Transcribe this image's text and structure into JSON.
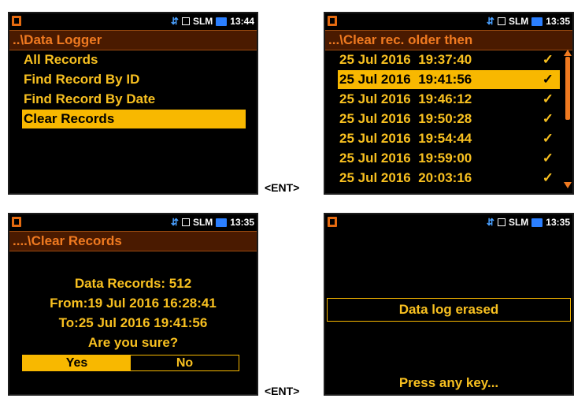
{
  "status": {
    "label": "SLM",
    "times": [
      "13:44",
      "13:35",
      "13:35",
      "13:35"
    ]
  },
  "panel1": {
    "title": "..\\Data Logger",
    "items": [
      "All Records",
      "Find Record By ID",
      "Find Record By Date",
      "Clear Records"
    ],
    "selected_index": 3
  },
  "panel2": {
    "title": "...\\Clear rec. older then",
    "records": [
      {
        "date": "25 Jul 2016",
        "time": "19:37:40",
        "mark": "✓"
      },
      {
        "date": "25 Jul 2016",
        "time": "19:41:56",
        "mark": "✓"
      },
      {
        "date": "25 Jul 2016",
        "time": "19:46:12",
        "mark": "✓"
      },
      {
        "date": "25 Jul 2016",
        "time": "19:50:28",
        "mark": "✓"
      },
      {
        "date": "25 Jul 2016",
        "time": "19:54:44",
        "mark": "✓"
      },
      {
        "date": "25 Jul 2016",
        "time": "19:59:00",
        "mark": "✓"
      },
      {
        "date": "25 Jul 2016",
        "time": "20:03:16",
        "mark": "✓"
      }
    ],
    "selected_index": 1
  },
  "panel3": {
    "title": "....\\Clear Records",
    "count_line": "Data Records: 512",
    "from_line": "From:19 Jul 2016 16:28:41",
    "to_line": "To:25 Jul 2016 19:41:56",
    "question": "Are you sure?",
    "yes": "Yes",
    "no": "No",
    "selected": "Yes"
  },
  "panel4": {
    "message": "Data log erased",
    "prompt": "Press any key..."
  },
  "connector_label": "<ENT>",
  "colors": {
    "accent": "#f8b800",
    "text": "#f8c020",
    "title": "#f07a20",
    "titlebar_bg": "#4a1a00",
    "screen_bg": "#000000",
    "usb": "#4aa0ff",
    "monitor": "#2b7fff"
  },
  "icons": [
    "battery-icon",
    "usb-icon",
    "square-icon",
    "monitor-icon",
    "check-icon",
    "scroll-up-icon",
    "scroll-down-icon"
  ]
}
